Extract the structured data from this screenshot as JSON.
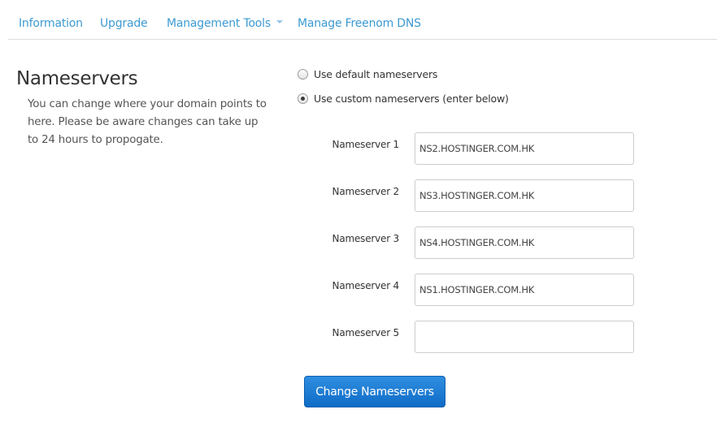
{
  "tabs": [
    {
      "label": "Information"
    },
    {
      "label": "Upgrade"
    },
    {
      "label": "Management Tools",
      "has_dropdown": true
    },
    {
      "label": "Manage Freenom DNS"
    }
  ],
  "section": {
    "title": "Nameservers",
    "description": "You can change where your domain points to here. Please be aware changes can take up to 24 hours to propogate."
  },
  "options": {
    "default_label": "Use default nameservers",
    "custom_label": "Use custom nameservers (enter below)",
    "selected": "custom"
  },
  "nameservers": [
    {
      "label": "Nameserver 1",
      "value": "NS2.HOSTINGER.COM.HK"
    },
    {
      "label": "Nameserver 2",
      "value": "NS3.HOSTINGER.COM.HK"
    },
    {
      "label": "Nameserver 3",
      "value": "NS4.HOSTINGER.COM.HK"
    },
    {
      "label": "Nameserver 4",
      "value": "NS1.HOSTINGER.COM.HK"
    },
    {
      "label": "Nameserver 5",
      "value": ""
    }
  ],
  "submit": {
    "label": "Change Nameservers"
  },
  "colors": {
    "link": "#3d9ad1",
    "button": "#1877d0",
    "text": "#333333"
  }
}
